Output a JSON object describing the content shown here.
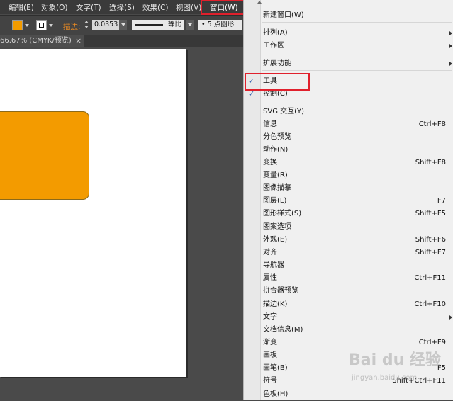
{
  "colors": {
    "fill_color": "#f39b00",
    "highlight_red": "#e0202c",
    "stroke_label_orange": "#e98a22",
    "check_blue": "#1a4fa8"
  },
  "menubar": {
    "items": [
      "编辑(E)",
      "对象(O)",
      "文字(T)",
      "选择(S)",
      "效果(C)",
      "视图(V)",
      "窗口(W)"
    ],
    "active": "窗口(W)"
  },
  "control_bar": {
    "stroke_label": "描边:",
    "stroke_value": "0.0353",
    "profile_label": "等比",
    "brush_label": "5 点圆形"
  },
  "document_tab": {
    "label": "66.67% (CMYK/预览)",
    "close": "×"
  },
  "window_menu": {
    "items": [
      {
        "label": "新建窗口(W)",
        "shortcut": "",
        "checked": false,
        "submenu": false
      },
      {
        "label": "排列(A)",
        "shortcut": "",
        "checked": false,
        "submenu": true
      },
      {
        "label": "工作区",
        "shortcut": "",
        "checked": false,
        "submenu": true
      },
      {
        "label": "扩展功能",
        "shortcut": "",
        "checked": false,
        "submenu": true
      },
      {
        "label": "工具",
        "shortcut": "",
        "checked": true,
        "submenu": false
      },
      {
        "label": "控制(C)",
        "shortcut": "",
        "checked": true,
        "submenu": false
      },
      {
        "label": "SVG 交互(Y)",
        "shortcut": "",
        "checked": false,
        "submenu": false
      },
      {
        "label": "信息",
        "shortcut": "Ctrl+F8",
        "checked": false,
        "submenu": false
      },
      {
        "label": "分色预览",
        "shortcut": "",
        "checked": false,
        "submenu": false
      },
      {
        "label": "动作(N)",
        "shortcut": "",
        "checked": false,
        "submenu": false
      },
      {
        "label": "变换",
        "shortcut": "Shift+F8",
        "checked": false,
        "submenu": false
      },
      {
        "label": "变量(R)",
        "shortcut": "",
        "checked": false,
        "submenu": false
      },
      {
        "label": "图像描摹",
        "shortcut": "",
        "checked": false,
        "submenu": false
      },
      {
        "label": "图层(L)",
        "shortcut": "F7",
        "checked": false,
        "submenu": false
      },
      {
        "label": "图形样式(S)",
        "shortcut": "Shift+F5",
        "checked": false,
        "submenu": false
      },
      {
        "label": "图案选项",
        "shortcut": "",
        "checked": false,
        "submenu": false
      },
      {
        "label": "外观(E)",
        "shortcut": "Shift+F6",
        "checked": false,
        "submenu": false
      },
      {
        "label": "对齐",
        "shortcut": "Shift+F7",
        "checked": false,
        "submenu": false
      },
      {
        "label": "导航器",
        "shortcut": "",
        "checked": false,
        "submenu": false
      },
      {
        "label": "属性",
        "shortcut": "Ctrl+F11",
        "checked": false,
        "submenu": false
      },
      {
        "label": "拼合器预览",
        "shortcut": "",
        "checked": false,
        "submenu": false
      },
      {
        "label": "描边(K)",
        "shortcut": "Ctrl+F10",
        "checked": false,
        "submenu": false
      },
      {
        "label": "文字",
        "shortcut": "",
        "checked": false,
        "submenu": true
      },
      {
        "label": "文档信息(M)",
        "shortcut": "",
        "checked": false,
        "submenu": false
      },
      {
        "label": "渐变",
        "shortcut": "Ctrl+F9",
        "checked": false,
        "submenu": false
      },
      {
        "label": "画板",
        "shortcut": "",
        "checked": false,
        "submenu": false
      },
      {
        "label": "画笔(B)",
        "shortcut": "F5",
        "checked": false,
        "submenu": false
      },
      {
        "label": "符号",
        "shortcut": "Shift+Ctrl+F11",
        "checked": false,
        "submenu": false
      },
      {
        "label": "色板(H)",
        "shortcut": "",
        "checked": false,
        "submenu": false
      }
    ]
  },
  "watermark": {
    "main": "Bai du 经验",
    "sub": "jingyan.baidu.com"
  }
}
